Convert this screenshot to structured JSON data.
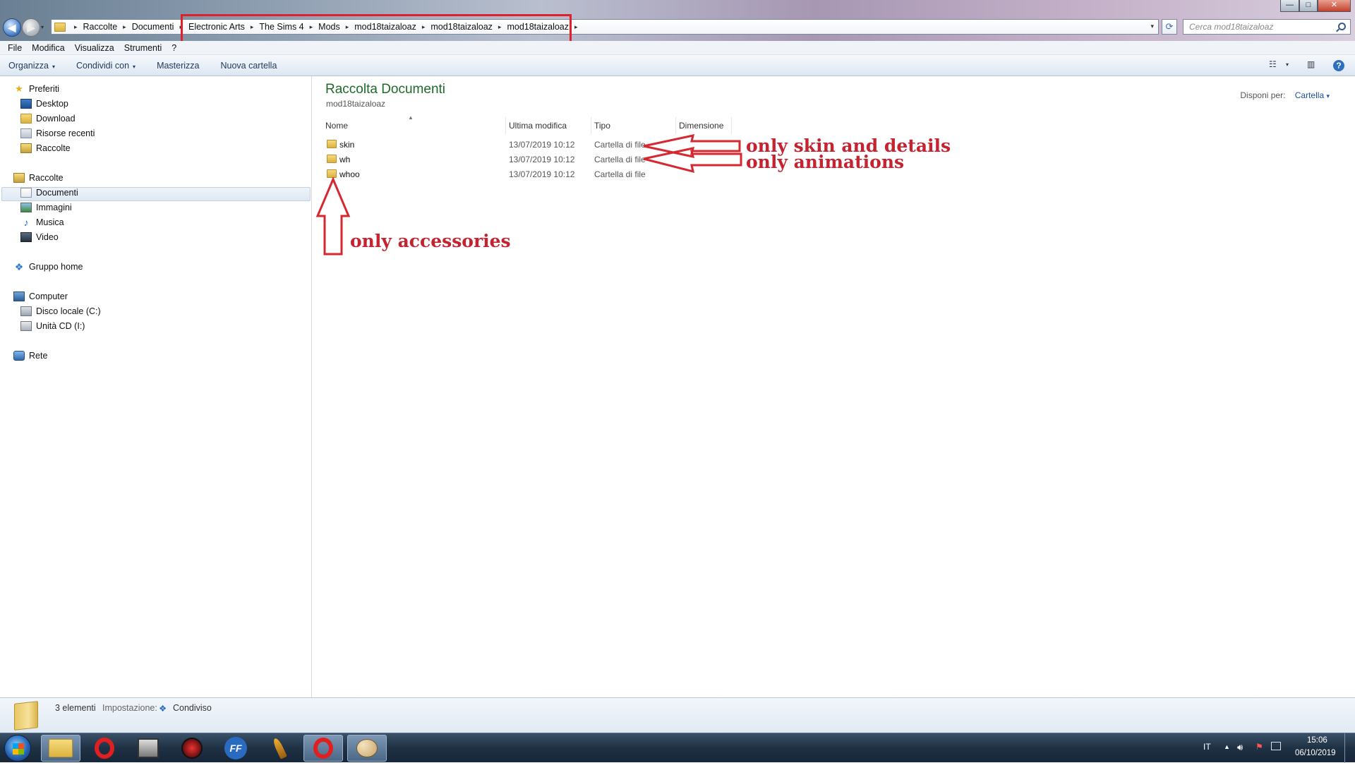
{
  "window": {
    "controls": {
      "minimize": "—",
      "maximize": "□",
      "close": "✕"
    }
  },
  "nav": {
    "back_icon": "◀",
    "forward_icon": "▶",
    "history_icon": "▾"
  },
  "address": {
    "crumbs": [
      "Raccolte",
      "Documenti",
      "Electronic Arts",
      "The Sims 4",
      "Mods",
      "mod18taizaloaz",
      "mod18taizaloaz",
      "mod18taizaloaz"
    ],
    "separator": "▸",
    "dropdown": "▾",
    "refresh_icon": "⟳"
  },
  "search": {
    "placeholder": "Cerca mod18taizaloaz"
  },
  "menu": [
    "File",
    "Modifica",
    "Visualizza",
    "Strumenti",
    "?"
  ],
  "toolbar": {
    "organize": "Organizza",
    "share": "Condividi con",
    "burn": "Masterizza",
    "new_folder": "Nuova cartella",
    "dropdown": "▾",
    "view_icon": "☷",
    "preview_icon": "▥",
    "help_icon": "?"
  },
  "sidebar": {
    "favorites": {
      "label": "Preferiti",
      "icon": "★",
      "items": [
        "Desktop",
        "Download",
        "Risorse recenti",
        "Raccolte"
      ]
    },
    "libraries": {
      "label": "Raccolte",
      "items": [
        "Documenti",
        "Immagini",
        "Musica",
        "Video"
      ]
    },
    "homegroup": {
      "label": "Gruppo home"
    },
    "computer": {
      "label": "Computer",
      "items": [
        "Disco locale (C:)",
        "Unità CD (I:)"
      ]
    },
    "network": {
      "label": "Rete"
    }
  },
  "main": {
    "title": "Raccolta Documenti",
    "subtitle": "mod18taizaloaz",
    "arrange_label": "Disponi per:",
    "arrange_value": "Cartella",
    "arrange_dropdown": "▾",
    "columns": [
      "Nome",
      "Ultima modifica",
      "Tipo",
      "Dimensione"
    ],
    "sort_indicator": "▲",
    "files": [
      {
        "name": "skin",
        "modified": "13/07/2019 10:12",
        "type": "Cartella di file"
      },
      {
        "name": "wh",
        "modified": "13/07/2019 10:12",
        "type": "Cartella di file"
      },
      {
        "name": "whoo",
        "modified": "13/07/2019 10:12",
        "type": "Cartella di file"
      }
    ]
  },
  "annotations": {
    "skin": "only skin and details",
    "wh": "only animations",
    "whoo": "only accessories",
    "color": "#c42330"
  },
  "status": {
    "count": "3 elementi",
    "setting_label": "Impostazione:",
    "setting_value": "Condiviso"
  },
  "taskbar": {
    "apps": [
      "explorer-icon",
      "opera-icon",
      "media-icon",
      "game-icon",
      "ffdec-icon",
      "feather-icon",
      "opera-icon",
      "paint-icon"
    ],
    "ffdec_label": "FF",
    "language": "IT",
    "tray_arrow": "▲",
    "time": "15:06",
    "date": "06/10/2019"
  }
}
